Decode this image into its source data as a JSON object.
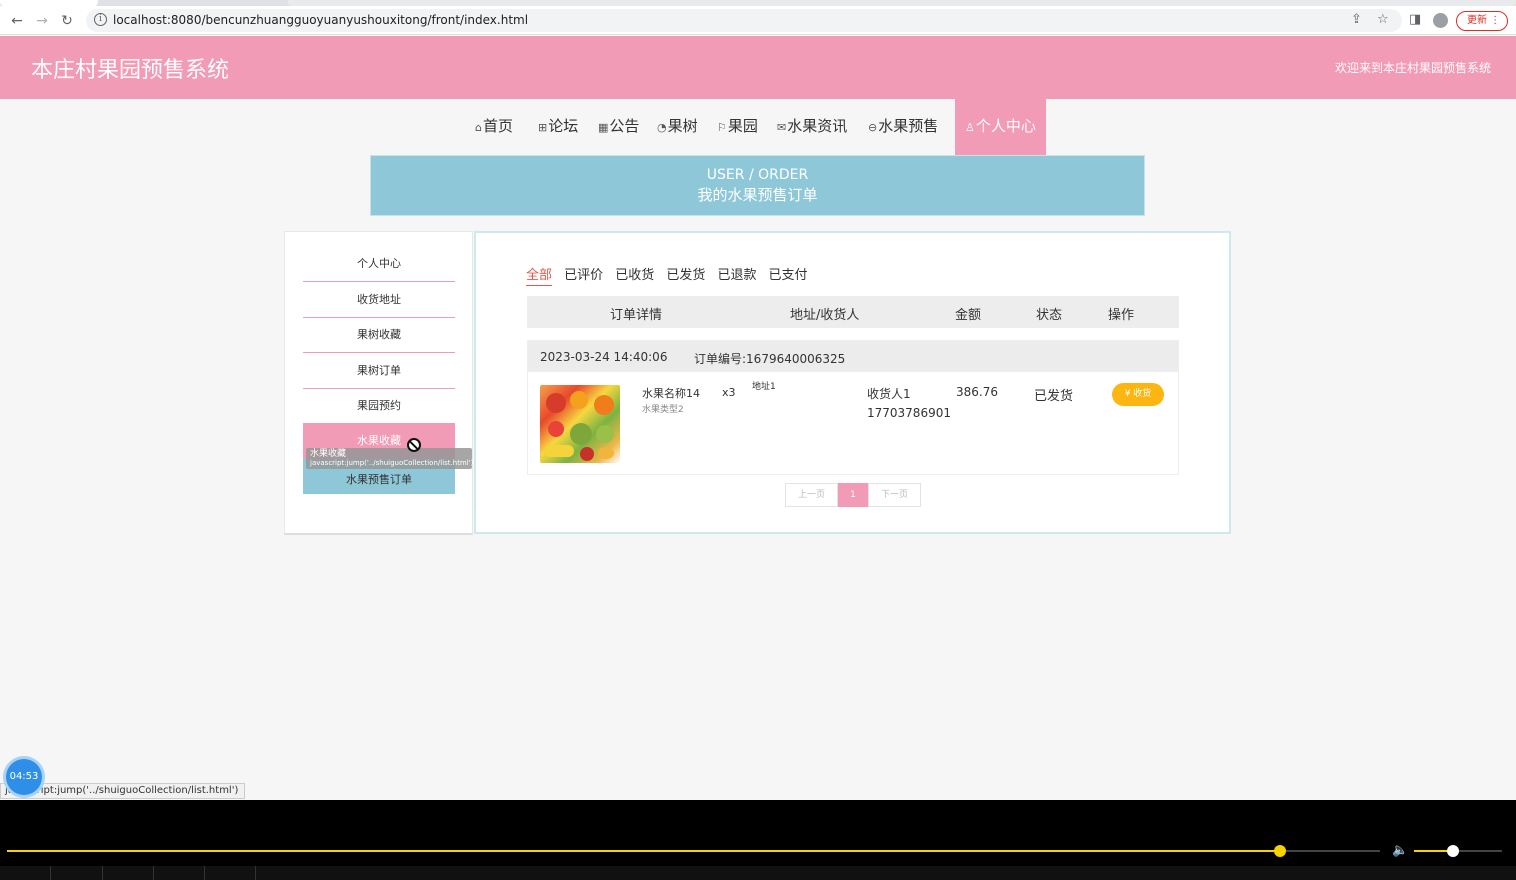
{
  "browser": {
    "url": "localhost:8080/bencunzhuangguoyuanyushouxitong/front/index.html",
    "update_label": "更新"
  },
  "header": {
    "title": "本庄村果园预售系统",
    "welcome": "欢迎来到本庄村果园预售系统"
  },
  "nav": {
    "home": "首页",
    "forum": "论坛",
    "notice": "公告",
    "trees": "果树",
    "orchard": "果园",
    "news": "水果资讯",
    "presale": "水果预售",
    "center": "个人中心"
  },
  "banner": {
    "en": "USER / ORDER",
    "zh": "我的水果预售订单"
  },
  "sidebar": {
    "items": [
      "个人中心",
      "收货地址",
      "果树收藏",
      "果树订单",
      "果园预约",
      "水果收藏",
      "水果预售订单"
    ],
    "tooltip_title": "水果收藏",
    "tooltip_link": "javascript:jump('../shuiguoCollection/list.html')"
  },
  "tabs": [
    "全部",
    "已评价",
    "已收货",
    "已发货",
    "已退款",
    "已支付"
  ],
  "table": {
    "headers": [
      "订单详情",
      "地址/收货人",
      "金额",
      "状态",
      "操作"
    ]
  },
  "order": {
    "time": "2023-03-24 14:40:06",
    "number": "订单编号:1679640006325",
    "product_name": "水果名称14",
    "product_type": "水果类型2",
    "quantity": "x3",
    "address": "地址1",
    "receiver": "收货人1",
    "phone": "17703786901",
    "amount": "386.76",
    "status": "已发货",
    "action": "收货",
    "action_icon": "¥"
  },
  "pager": {
    "prev": "上一页",
    "current": "1",
    "next": "下一页"
  },
  "overlay": {
    "timer": "04:53",
    "status_url": "javascript:jump('../shuiguoCollection/list.html')"
  },
  "player": {
    "progress": 0.927,
    "volume": 0.44
  }
}
